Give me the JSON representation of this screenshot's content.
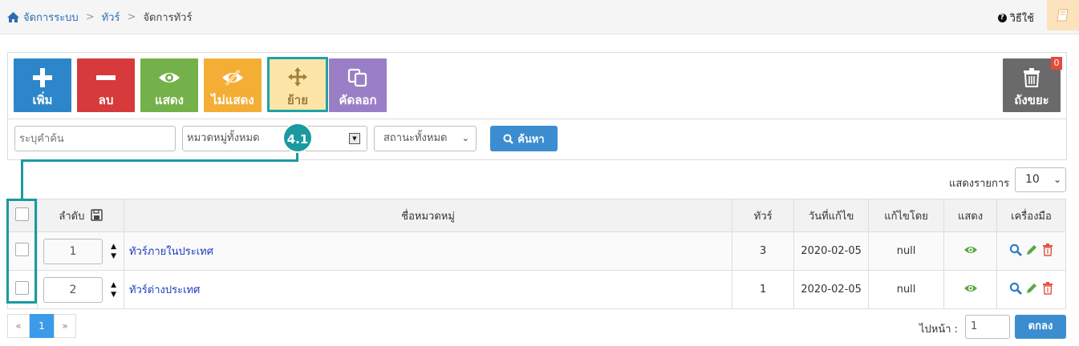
{
  "breadcrumb": {
    "home": "จัดการระบบ",
    "section": "ทัวร์",
    "current": "จัดการทัวร์",
    "separator": ">"
  },
  "help": {
    "label": "วิธีใช้"
  },
  "toolbar": {
    "add": "เพิ่ม",
    "delete": "ลบ",
    "show": "แสดง",
    "hide": "ไม่แสดง",
    "move": "ย้าย",
    "copy": "คัดลอก",
    "trash": "ถังขยะ",
    "trash_count": "0"
  },
  "filters": {
    "keyword_placeholder": "ระบุคำค้น",
    "category": "หมวดหมู่ทั้งหมด",
    "status": "สถานะทั้งหมด",
    "search_button": "ค้นหา"
  },
  "annotation": {
    "label": "4.1"
  },
  "list": {
    "show_label": "แสดงรายการ",
    "page_size": "10"
  },
  "table": {
    "headers": {
      "order": "ลำดับ",
      "name": "ชื่อหมวดหมู่",
      "tours": "ทัวร์",
      "date": "วันที่แก้ไข",
      "editor": "แก้ไขโดย",
      "visible": "แสดง",
      "tools": "เครื่องมือ"
    },
    "rows": [
      {
        "order": "1",
        "name": "ทัวร์ภายในประเทศ",
        "tours": "3",
        "date": "2020-02-05",
        "editor": "null"
      },
      {
        "order": "2",
        "name": "ทัวร์ต่างประเทศ",
        "tours": "1",
        "date": "2020-02-05",
        "editor": "null"
      }
    ]
  },
  "pagination": {
    "prev": "«",
    "page": "1",
    "next": "»",
    "goto_label": "ไปหน้า :",
    "goto_value": "1",
    "go_button": "ตกลง"
  },
  "colors": {
    "accent": "#1a9aa0",
    "primary": "#3c8dd0",
    "add": "#2c86c9",
    "delete": "#d63a3a",
    "show": "#74b14a",
    "hide": "#f4ae35",
    "move": "#fde5a8",
    "copy": "#9a7fc6",
    "trash": "#6a6a6a"
  },
  "icons": [
    "home-icon",
    "help-icon",
    "book-icon",
    "plus-icon",
    "minus-icon",
    "eye-icon",
    "eye-slash-icon",
    "move-icon",
    "copy-icon",
    "trash-icon",
    "save-icon",
    "search-icon",
    "pencil-icon"
  ]
}
